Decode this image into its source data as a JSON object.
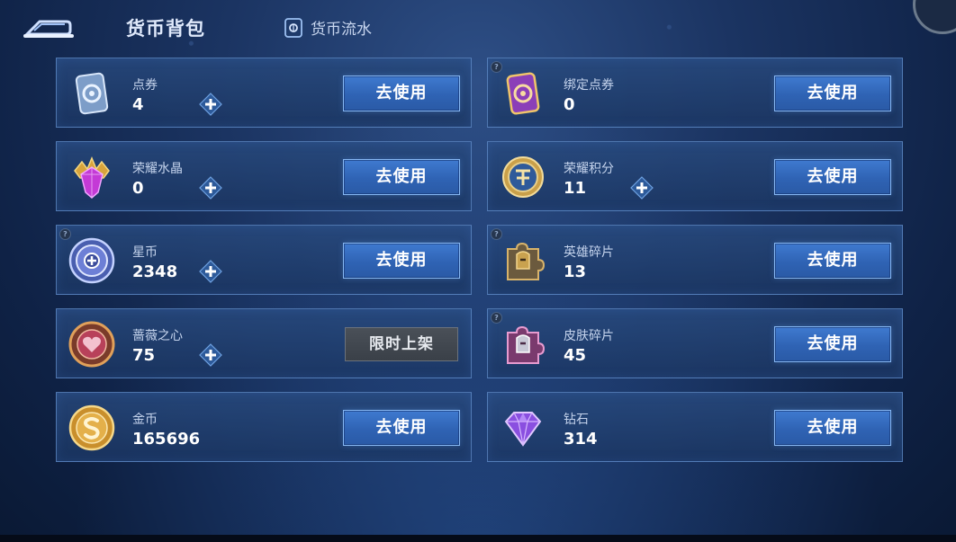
{
  "header": {
    "title": "货币背包",
    "flow_label": "货币流水"
  },
  "colors": {
    "panel_border": "#78aaeb",
    "button_blue": "#2f63b4",
    "button_border": "#86b7f3",
    "disabled_button": "#3a4048"
  },
  "currencies": [
    {
      "name": "点券",
      "value": "4",
      "icon": "coupon-icon",
      "plus": true,
      "help": false,
      "button": "去使用"
    },
    {
      "name": "绑定点券",
      "value": "0",
      "icon": "bound-coupon-icon",
      "plus": false,
      "help": true,
      "button": "去使用"
    },
    {
      "name": "荣耀水晶",
      "value": "0",
      "icon": "glory-crystal-icon",
      "plus": true,
      "help": false,
      "button": "去使用"
    },
    {
      "name": "荣耀积分",
      "value": "11",
      "icon": "glory-points-icon",
      "plus": true,
      "help": false,
      "button": "去使用"
    },
    {
      "name": "星币",
      "value": "2348",
      "icon": "star-coin-icon",
      "plus": true,
      "help": true,
      "button": "去使用"
    },
    {
      "name": "英雄碎片",
      "value": "13",
      "icon": "hero-fragment-icon",
      "plus": false,
      "help": true,
      "button": "去使用"
    },
    {
      "name": "蔷薇之心",
      "value": "75",
      "icon": "rose-heart-icon",
      "plus": true,
      "help": false,
      "button": "限时上架",
      "button_disabled": true
    },
    {
      "name": "皮肤碎片",
      "value": "45",
      "icon": "skin-fragment-icon",
      "plus": false,
      "help": true,
      "button": "去使用"
    },
    {
      "name": "金币",
      "value": "165696",
      "icon": "gold-coin-icon",
      "plus": false,
      "help": false,
      "button": "去使用"
    },
    {
      "name": "钻石",
      "value": "314",
      "icon": "diamond-icon",
      "plus": false,
      "help": false,
      "button": "去使用"
    }
  ]
}
